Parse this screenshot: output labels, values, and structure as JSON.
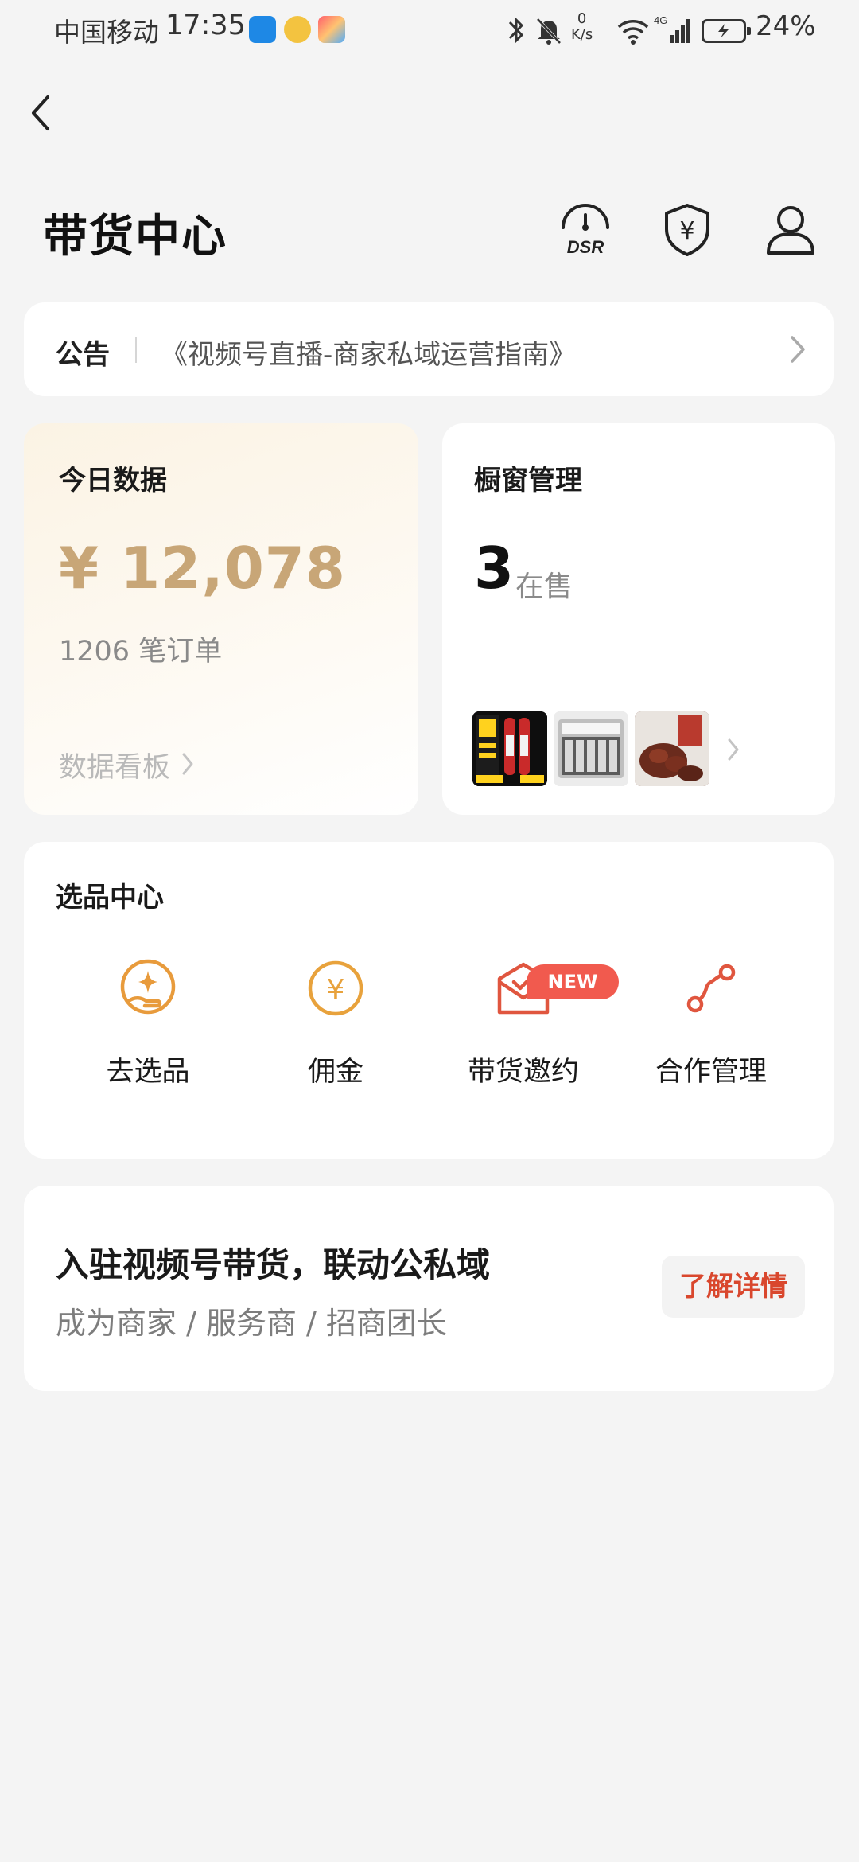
{
  "status_bar": {
    "carrier": "中国移动",
    "time": "17:35",
    "net_speed_value": "0",
    "net_speed_unit": "K/s",
    "network_type": "4G",
    "battery": "24%"
  },
  "header": {
    "title": "带货中心",
    "dsr_label": "DSR",
    "shield_symbol": "¥"
  },
  "notice": {
    "label": "公告",
    "text": "《视频号直播-商家私域运营指南》"
  },
  "data_card": {
    "title": "今日数据",
    "amount": "¥ 12,078",
    "orders": "1206 笔订单",
    "link": "数据看板"
  },
  "window_card": {
    "title": "橱窗管理",
    "count": "3",
    "unit": "在售"
  },
  "select_center": {
    "title": "选品中心",
    "new_badge": "NEW",
    "tools": [
      {
        "label": "去选品",
        "icon": "select-product-icon"
      },
      {
        "label": "佣金",
        "icon": "commission-icon",
        "symbol": "¥"
      },
      {
        "label": "带货邀约",
        "icon": "invitation-icon"
      },
      {
        "label": "合作管理",
        "icon": "cooperation-icon"
      }
    ]
  },
  "join": {
    "title": "入驻视频号带货，联动公私域",
    "subtitle": "成为商家 / 服务商 / 招商团长",
    "button": "了解详情"
  },
  "colors": {
    "accent_gold": "#c8a677",
    "accent_orange": "#e89b3c",
    "accent_red": "#d9472d",
    "badge_red": "#f15a4e"
  }
}
